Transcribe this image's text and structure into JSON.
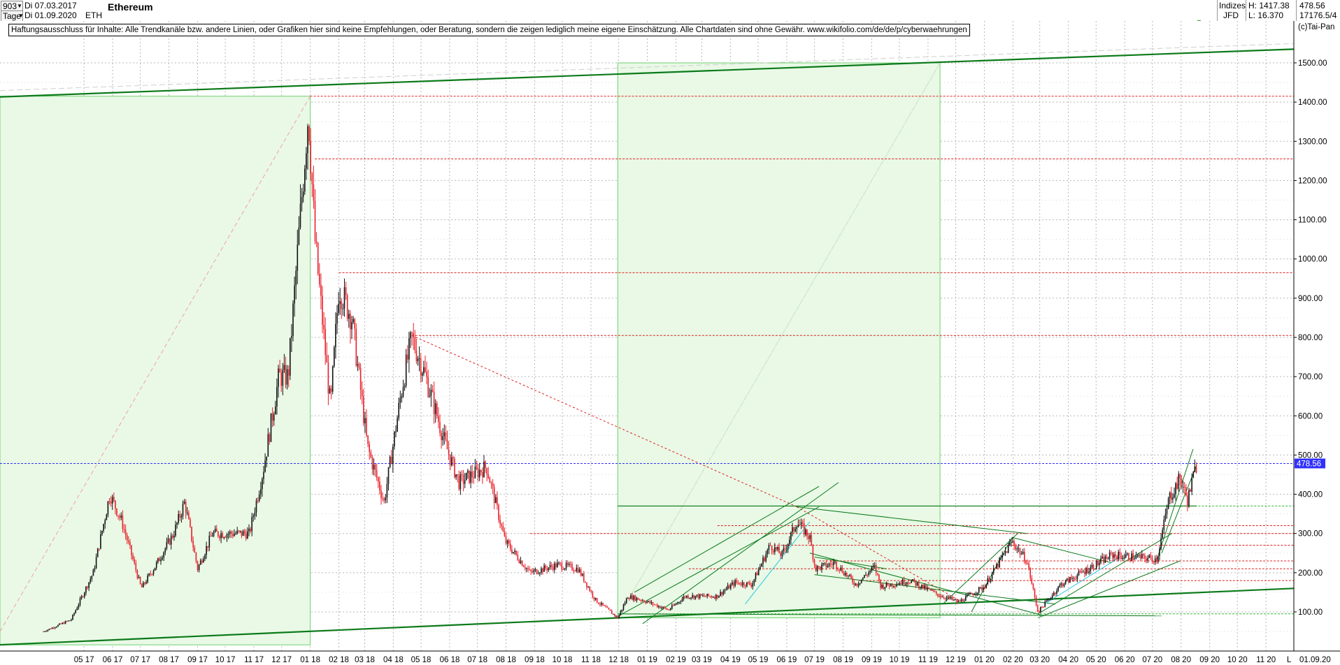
{
  "header": {
    "period_value": "903",
    "start_date": "Di 07.03.2017",
    "interval": "Tage",
    "end_date": "Di 01.09.2020",
    "symbol": "ETH",
    "title": "Ethereum",
    "category": "Indizes",
    "source": "JFD",
    "high_label": "H: 1417.38",
    "low_label": "L: 16.370",
    "last_value": "478.56",
    "volume_value": "17176.5/4"
  },
  "disclaimer": "Haftungsausschluss für Inhalte: Alle Trendkanäle bzw. andere Linien, oder Grafiken hier sind keine Empfehlungen, oder Beratung, sondern die zeigen lediglich meine eigene Einschätzung. Alle Chartdaten sind ohne Gewähr.  www.wikifolio.com/de/de/p/cyberwaehrungen",
  "copyright": "(c)Tai-Pan",
  "footer": {
    "scale_letter": "L",
    "end_date": "01.09.20"
  },
  "colors": {
    "up": "#111111",
    "down": "#e8202a",
    "price_line": "#3030ff",
    "trend_green": "#0b7a1a",
    "zone_fill": "#e9f9e6",
    "zone_border": "#6fd06f",
    "resistance": "#e02020",
    "grid": "#b8b8b8"
  },
  "chart_data": {
    "type": "candlestick",
    "title": "Ethereum",
    "y_axis": {
      "ticks": [
        100,
        200,
        300,
        400,
        500,
        600,
        700,
        800,
        900,
        1000,
        1100,
        1200,
        1300,
        1400,
        1500
      ],
      "tick_labels": [
        "100.00",
        "200.00",
        "300.00",
        "400.00",
        "500.00",
        "600.00",
        "700.00",
        "800.00",
        "900.00",
        "1000.00",
        "1100.00",
        "1200.00",
        "1300.00",
        "1400.00",
        "1500.00"
      ],
      "ylim": [
        0,
        1560
      ],
      "side": "right"
    },
    "x_axis": {
      "tick_labels": [
        "05 17",
        "06 17",
        "07 17",
        "08 17",
        "09 17",
        "10 17",
        "11 17",
        "12 17",
        "01 18",
        "02 18",
        "03 18",
        "04 18",
        "05 18",
        "06 18",
        "07 18",
        "08 18",
        "09 18",
        "10 18",
        "11 18",
        "12 18",
        "01 19",
        "02 19",
        "03 19",
        "04 19",
        "05 19",
        "06 19",
        "07 19",
        "08 19",
        "09 19",
        "10 19",
        "11 19",
        "12 19",
        "01 20",
        "02 20",
        "03 20",
        "04 20",
        "05 20",
        "06 20",
        "07 20",
        "08 20",
        "09 20",
        "10 20",
        "11 20"
      ],
      "range": [
        "2017-04-01",
        "2020-11-30"
      ]
    },
    "price_path": [
      [
        "2017-04-01",
        50
      ],
      [
        "2017-05-01",
        80
      ],
      [
        "2017-05-25",
        200
      ],
      [
        "2017-06-12",
        400
      ],
      [
        "2017-06-25",
        330
      ],
      [
        "2017-07-16",
        160
      ],
      [
        "2017-08-01",
        220
      ],
      [
        "2017-08-20",
        300
      ],
      [
        "2017-09-01",
        380
      ],
      [
        "2017-09-15",
        210
      ],
      [
        "2017-10-01",
        300
      ],
      [
        "2017-10-20",
        300
      ],
      [
        "2017-11-10",
        300
      ],
      [
        "2017-11-25",
        460
      ],
      [
        "2017-12-12",
        700
      ],
      [
        "2017-12-22",
        700
      ],
      [
        "2018-01-13",
        1380
      ],
      [
        "2018-01-20",
        1050
      ],
      [
        "2018-02-06",
        620
      ],
      [
        "2018-02-15",
        930
      ],
      [
        "2018-03-01",
        850
      ],
      [
        "2018-03-18",
        520
      ],
      [
        "2018-04-05",
        380
      ],
      [
        "2018-04-25",
        680
      ],
      [
        "2018-05-05",
        800
      ],
      [
        "2018-05-20",
        700
      ],
      [
        "2018-06-10",
        530
      ],
      [
        "2018-06-25",
        430
      ],
      [
        "2018-07-25",
        470
      ],
      [
        "2018-08-14",
        280
      ],
      [
        "2018-09-10",
        200
      ],
      [
        "2018-10-10",
        220
      ],
      [
        "2018-11-01",
        210
      ],
      [
        "2018-11-20",
        130
      ],
      [
        "2018-12-14",
        85
      ],
      [
        "2018-12-25",
        140
      ],
      [
        "2019-01-10",
        130
      ],
      [
        "2019-02-07",
        105
      ],
      [
        "2019-02-25",
        140
      ],
      [
        "2019-03-31",
        140
      ],
      [
        "2019-04-20",
        175
      ],
      [
        "2019-05-08",
        170
      ],
      [
        "2019-05-28",
        270
      ],
      [
        "2019-06-10",
        245
      ],
      [
        "2019-06-26",
        330
      ],
      [
        "2019-07-10",
        290
      ],
      [
        "2019-07-16",
        210
      ],
      [
        "2019-08-06",
        225
      ],
      [
        "2019-08-29",
        170
      ],
      [
        "2019-09-18",
        215
      ],
      [
        "2019-09-25",
        165
      ],
      [
        "2019-10-26",
        180
      ],
      [
        "2019-11-25",
        145
      ],
      [
        "2019-12-18",
        125
      ],
      [
        "2020-01-15",
        165
      ],
      [
        "2020-02-14",
        280
      ],
      [
        "2020-03-01",
        230
      ],
      [
        "2020-03-13",
        100
      ],
      [
        "2020-04-07",
        170
      ],
      [
        "2020-05-07",
        210
      ],
      [
        "2020-06-01",
        245
      ],
      [
        "2020-07-20",
        235
      ],
      [
        "2020-08-02",
        390
      ],
      [
        "2020-08-14",
        440
      ],
      [
        "2020-08-22",
        385
      ],
      [
        "2020-09-01",
        478.56
      ]
    ],
    "last_price": 478.56,
    "all_time_high": 1417.38,
    "resistance_levels": [
      1415,
      1255,
      965,
      805,
      370,
      320,
      300,
      270,
      230,
      210,
      180,
      95
    ]
  }
}
